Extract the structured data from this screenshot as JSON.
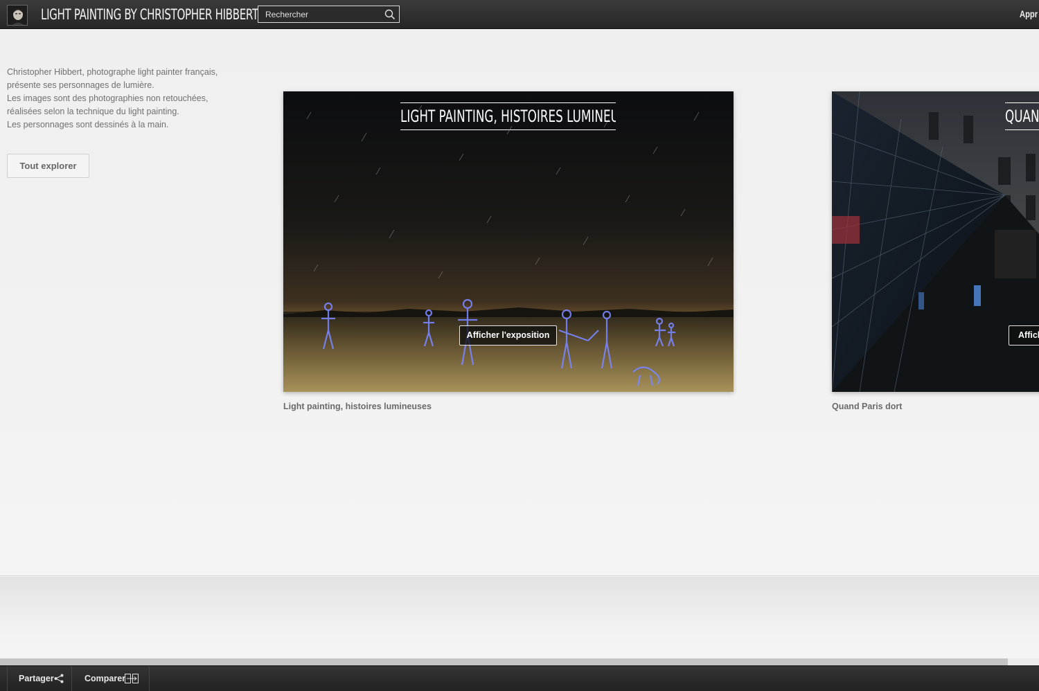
{
  "header": {
    "site_title": "LIGHT PAINTING BY CHRISTOPHER HIBBERT",
    "search": {
      "placeholder": "Rechercher",
      "value": ""
    },
    "right_link": "Appr"
  },
  "intro": {
    "lines": [
      "Christopher Hibbert, photographe light painter français,",
      "présente ses personnages de lumière.",
      "Les images sont des photographies non retouchées,",
      "réalisées selon la technique du light painting.",
      "Les personnages sont dessinés à la main."
    ],
    "explore_button": "Tout explorer"
  },
  "exhibitions": [
    {
      "heading": "LIGHT PAINTING, HISTOIRES LUMINEUSES",
      "button": "Afficher l'exposition",
      "caption": "Light painting, histoires lumineuses"
    },
    {
      "heading": "QUAND",
      "button": "Affich",
      "caption": "Quand Paris dort"
    }
  ],
  "toolbar": {
    "share": "Partager",
    "compare": "Comparer"
  },
  "icons": {
    "search": "search-icon",
    "share": "share-icon",
    "compare": "compare-icon",
    "avatar": "avatar"
  },
  "colors": {
    "header_bg": "#2f2f2f",
    "page_bg": "#f1f1f1",
    "text_gray": "#707070",
    "toolbar_bg": "#2a2a2a"
  }
}
